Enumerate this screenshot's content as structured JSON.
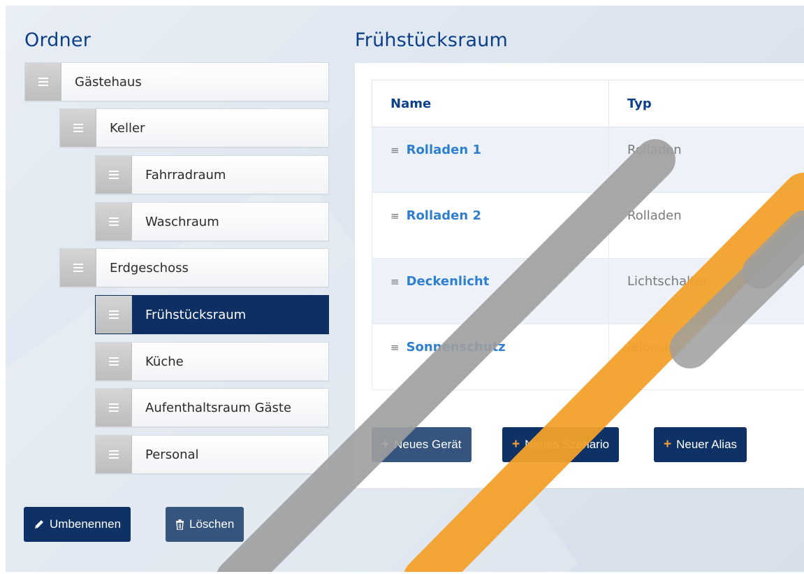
{
  "sidebar": {
    "title": "Ordner",
    "items": [
      {
        "label": "Gästehaus",
        "active": false
      },
      {
        "label": "Keller",
        "active": false
      },
      {
        "label": "Fahrradraum",
        "active": false
      },
      {
        "label": "Waschraum",
        "active": false
      },
      {
        "label": "Erdgeschoss",
        "active": false
      },
      {
        "label": "Frühstücksraum",
        "active": true
      },
      {
        "label": "Küche",
        "active": false
      },
      {
        "label": "Aufenthaltsraum Gäste",
        "active": false
      },
      {
        "label": "Personal",
        "active": false
      }
    ],
    "rename_label": "Umbenennen",
    "delete_label": "Löschen"
  },
  "main": {
    "title": "Frühstücksraum",
    "columns": [
      "Name",
      "Typ"
    ],
    "rows": [
      {
        "name": "Rolladen 1",
        "type": "Rolladen"
      },
      {
        "name": "Rolladen 2",
        "type": "Rolladen"
      },
      {
        "name": "Deckenlicht",
        "type": "Lichtschalter"
      },
      {
        "name": "Sonnenschutz",
        "type": "Jalousie"
      }
    ],
    "grip_glyph": "≡",
    "buttons": {
      "plus_glyph": "+",
      "new_device": "Neues Gerät",
      "new_scenario": "Neues Szenario",
      "new_alias": "Neuer Alias"
    }
  },
  "colors": {
    "heading": "#0b3f88",
    "active_item": "#0d2f63",
    "link": "#2f7fd0",
    "plus_orange": "#f4a23a",
    "watermark_gray": "#9e9e9e",
    "watermark_orange": "#f2a12a"
  },
  "icons": {
    "handle": "drag-handle-icon",
    "rename": "pencil-icon",
    "delete": "trash-icon"
  }
}
